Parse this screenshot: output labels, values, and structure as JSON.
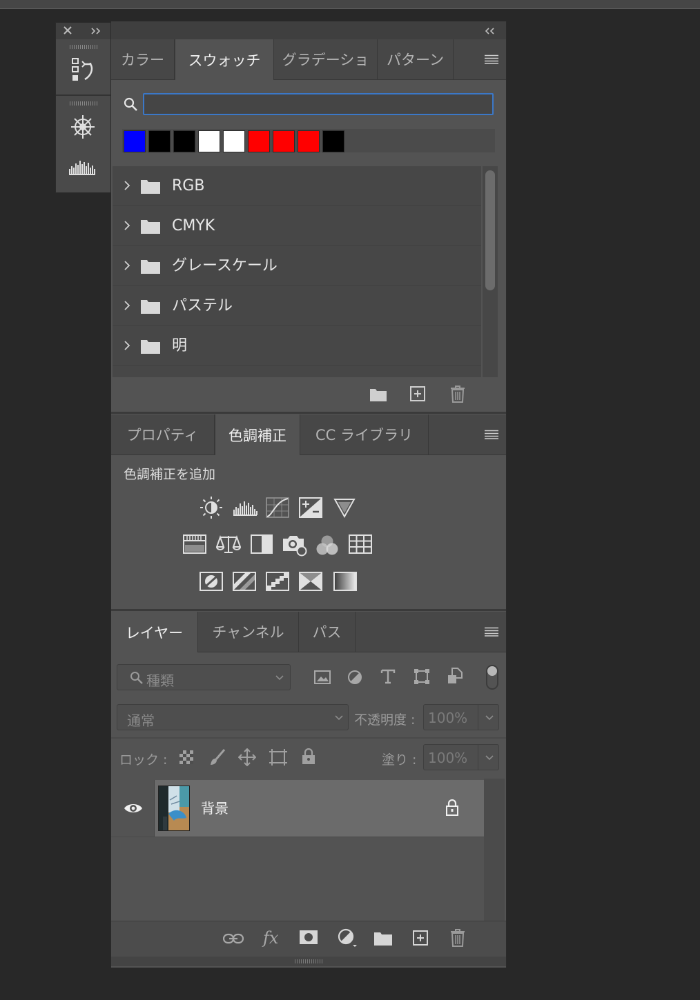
{
  "dock": {
    "tools": [
      "history-icon",
      "brush-settings-icon",
      "histogram-icon"
    ]
  },
  "swatches_panel": {
    "tabs": [
      "カラー",
      "スウォッチ",
      "グラデーショ",
      "パターン"
    ],
    "active_tab": "スウォッチ",
    "search": {
      "value": "",
      "placeholder": ""
    },
    "recent_colors": [
      "#0000ff",
      "#000000",
      "#000000",
      "#ffffff",
      "#ffffff",
      "#ff0000",
      "#ff0000",
      "#ff0000",
      "#000000"
    ],
    "groups": [
      {
        "label": "RGB"
      },
      {
        "label": "CMYK"
      },
      {
        "label": "グレースケール"
      },
      {
        "label": "パステル"
      },
      {
        "label": "明"
      }
    ],
    "footer_icons": [
      "new-group-icon",
      "new-swatch-icon",
      "trash-icon"
    ]
  },
  "adjustments_panel": {
    "tabs": [
      "プロパティ",
      "色調補正",
      "CC ライブラリ"
    ],
    "active_tab": "色調補正",
    "title": "色調補正を追加",
    "rows": [
      [
        "brightness-contrast-icon",
        "levels-icon",
        "curves-icon",
        "exposure-icon",
        "vibrance-icon"
      ],
      [
        "hue-saturation-icon",
        "color-balance-icon",
        "black-white-icon",
        "photo-filter-icon",
        "channel-mixer-icon",
        "color-lookup-icon"
      ],
      [
        "invert-icon",
        "posterize-icon",
        "threshold-icon",
        "selective-color-icon",
        "gradient-map-icon"
      ]
    ]
  },
  "layers_panel": {
    "tabs": [
      "レイヤー",
      "チャンネル",
      "パス"
    ],
    "active_tab": "レイヤー",
    "filter_kind": "種類",
    "blend_mode": "通常",
    "opacity_label": "不透明度 :",
    "opacity_value": "100%",
    "lock_label": "ロック :",
    "fill_label": "塗り :",
    "fill_value": "100%",
    "layers": [
      {
        "name": "背景",
        "visible": true,
        "locked": true
      }
    ],
    "footer_icons": [
      "link-icon",
      "fx-icon",
      "mask-icon",
      "adjustment-layer-icon",
      "group-icon",
      "new-layer-icon",
      "trash-icon"
    ]
  },
  "colors": {
    "accent": "#3b78c8",
    "panel_bg": "#535353",
    "tabbar_bg": "#474747",
    "selected_layer": "#6b6b6b"
  }
}
